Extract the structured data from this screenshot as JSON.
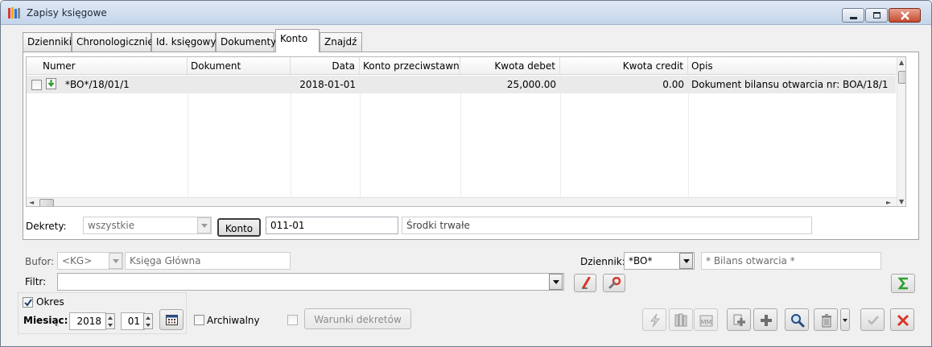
{
  "window": {
    "title": "Zapisy księgowe"
  },
  "tabs": [
    "Dzienniki",
    "Chronologicznie",
    "Id. księgowy",
    "Dokumenty",
    "Konto",
    "Znajdź"
  ],
  "active_tab": "Konto",
  "grid": {
    "columns": [
      "Numer",
      "Dokument",
      "Data",
      "Konto przeciwstawne",
      "Kwota debet",
      "Kwota credit",
      "Opis"
    ],
    "rows": [
      {
        "numer": "*BO*/18/01/1",
        "dokument": "",
        "data": "2018-01-01",
        "konto_przeciwstawne": "",
        "kwota_debet": "25,000.00",
        "kwota_credit": "0.00",
        "opis": "Dokument bilansu otwarcia nr: BOA/18/1"
      }
    ]
  },
  "dekrety": {
    "label": "Dekrety:",
    "select_value": "wszystkie",
    "konto_button": "Konto",
    "konto_value": "011-01",
    "konto_name": "Środki trwałe"
  },
  "bufor": {
    "label": "Bufor:",
    "code": "<KG>",
    "name": "Księga Główna"
  },
  "dziennik": {
    "label": "Dziennik:",
    "code": "*BO*",
    "name": "* Bilans otwarcia *"
  },
  "filtr": {
    "label": "Filtr:",
    "value": ""
  },
  "okres": {
    "label": "Okres",
    "checked": true,
    "miesiac_label": "Miesiąc:",
    "year": "2018",
    "month": "01"
  },
  "archiwalny": {
    "label": "Archiwalny",
    "checked": false
  },
  "warunki": {
    "label": "Warunki dekretów",
    "checked": false
  },
  "icons": {
    "sum": "sigma-icon",
    "filter_clear": "eraser-icon",
    "filter_edit": "wrench-icon",
    "calendar": "calendar-icon",
    "add_copy": "add-copy-icon",
    "add": "plus-icon",
    "search": "magnifier-icon",
    "delete": "trash-icon",
    "ok": "checkmark-icon",
    "cancel": "close-icon"
  },
  "colors": {
    "accent_red": "#d8372a",
    "sum_green": "#2f9e2f",
    "row_selected": "#eaeaea"
  }
}
